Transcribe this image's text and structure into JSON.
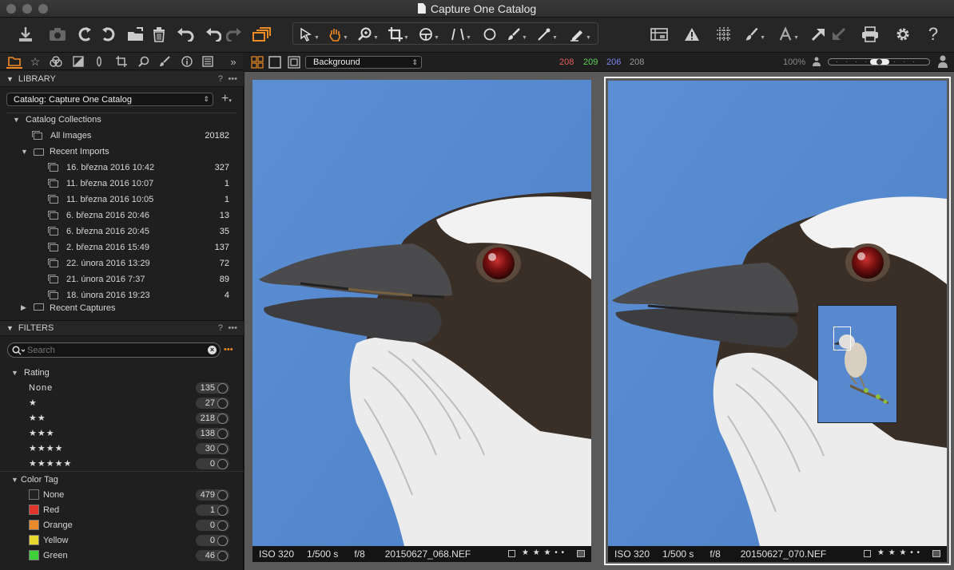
{
  "window": {
    "title": "Capture One Catalog"
  },
  "toolbar": {
    "icons": [
      "import-icon",
      "camera-icon",
      "rotate-left-icon",
      "rotate-right-icon",
      "move-to-folder-icon",
      "trash-icon",
      "undo-adjust-icon",
      "undo-icon",
      "redo-icon",
      "variants-icon",
      "select-icon",
      "pan-hand-icon",
      "zoom-icon",
      "crop-icon",
      "rotate-straighten-icon",
      "keystone-icon",
      "circle-mask-icon",
      "brush-icon",
      "color-picker-icon",
      "annotate-icon",
      "grid-layout-icon",
      "warning-icon",
      "grid-overlay-icon",
      "paint-icon",
      "text-icon",
      "arrow-up-icon",
      "arrow-down-icon",
      "print-icon",
      "settings-icon",
      "help-icon"
    ],
    "help_label": "?"
  },
  "library": {
    "header": "LIBRARY",
    "help": "?",
    "catalog_select": "Catalog: Capture One Catalog",
    "collections_label": "Catalog Collections",
    "all_images": {
      "label": "All Images",
      "count": "20182"
    },
    "recent_imports": "Recent Imports",
    "imports": [
      {
        "label": "16. března 2016 10:42",
        "count": "327"
      },
      {
        "label": "11. března 2016 10:07",
        "count": "1"
      },
      {
        "label": "11. března 2016 10:05",
        "count": "1"
      },
      {
        "label": "6. března 2016 20:46",
        "count": "13"
      },
      {
        "label": "6. března 2016 20:45",
        "count": "35"
      },
      {
        "label": "2. března 2016 15:49",
        "count": "137"
      },
      {
        "label": "22. února 2016 13:29",
        "count": "72"
      },
      {
        "label": "21. února 2016 7:37",
        "count": "89"
      },
      {
        "label": "18. února 2016 19:23",
        "count": "4"
      }
    ],
    "recent_captures": "Recent Captures"
  },
  "filters": {
    "header": "FILTERS",
    "help": "?",
    "search_placeholder": "Search",
    "rating_label": "Rating",
    "ratings": [
      {
        "label": "None",
        "count": "135"
      },
      {
        "label": "★",
        "count": "27"
      },
      {
        "label": "★★",
        "count": "218"
      },
      {
        "label": "★★★",
        "count": "138"
      },
      {
        "label": "★★★★",
        "count": "30"
      },
      {
        "label": "★★★★★",
        "count": "0"
      }
    ],
    "color_tag_label": "Color Tag",
    "color_tags": [
      {
        "label": "None",
        "count": "479",
        "color": "#222222"
      },
      {
        "label": "Red",
        "count": "1",
        "color": "#e0352b"
      },
      {
        "label": "Orange",
        "count": "0",
        "color": "#e8892b"
      },
      {
        "label": "Yellow",
        "count": "0",
        "color": "#e6d82c"
      },
      {
        "label": "Green",
        "count": "46",
        "color": "#3fd13a"
      }
    ]
  },
  "viewer": {
    "style_select": "Background",
    "rgb": {
      "r": "208",
      "g": "209",
      "b": "206",
      "l": "208"
    },
    "zoom": "100%",
    "images": [
      {
        "iso": "ISO 320",
        "shutter": "1/500 s",
        "aperture": "f/8",
        "filename": "20150627_068.NEF",
        "rating": "★ ★ ★ • •"
      },
      {
        "iso": "ISO 320",
        "shutter": "1/500 s",
        "aperture": "f/8",
        "filename": "20150627_070.NEF",
        "rating": "★ ★ ★ • •"
      }
    ]
  },
  "colors": {
    "accent": "#f08a24",
    "red_val": "#e0605a",
    "green_val": "#5fd35a",
    "blue_val": "#7b86f0"
  }
}
